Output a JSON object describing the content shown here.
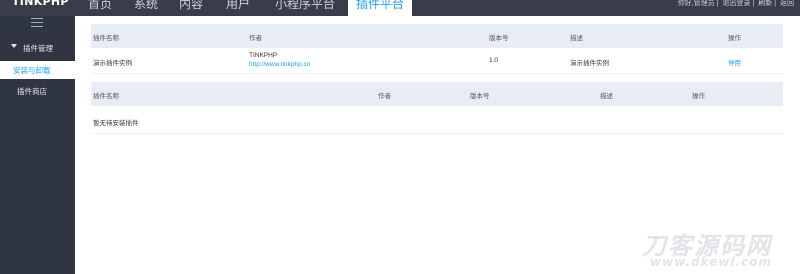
{
  "app": {
    "logo": "TINKPHP"
  },
  "nav": {
    "items": [
      {
        "label": "首页"
      },
      {
        "label": "系统"
      },
      {
        "label": "内容"
      },
      {
        "label": "用户"
      },
      {
        "label": "小程序平台"
      },
      {
        "label": "插件平台"
      }
    ],
    "active_index": 5
  },
  "user": {
    "name": "你好,管理员",
    "links": [
      "退出登录",
      "刷新",
      "返回"
    ]
  },
  "sidebar": {
    "group_label": "插件管理",
    "items": [
      {
        "label": "安装与卸载"
      },
      {
        "label": "插件商店"
      }
    ]
  },
  "installed": {
    "headers": [
      "插件名称",
      "作者",
      "版本号",
      "描述",
      "操作"
    ],
    "rows": [
      {
        "name": "演示插件实例",
        "author": "TINKPHP",
        "author_url": "http://www.tinkphp.cn",
        "version": "1.0",
        "description": "演示插件实例",
        "action": "停用"
      }
    ]
  },
  "pending": {
    "headers": [
      "插件名称",
      "作者",
      "版本号",
      "描述",
      "操作"
    ],
    "empty_text": "暂无待安装插件"
  },
  "watermark": {
    "title": "刀客源码网",
    "url": "www.dkewl.com"
  },
  "colors": {
    "topbar": "#393d49",
    "sidebar": "#2f3641",
    "accent": "#1e9fff",
    "table_header": "#e8ecf4"
  }
}
